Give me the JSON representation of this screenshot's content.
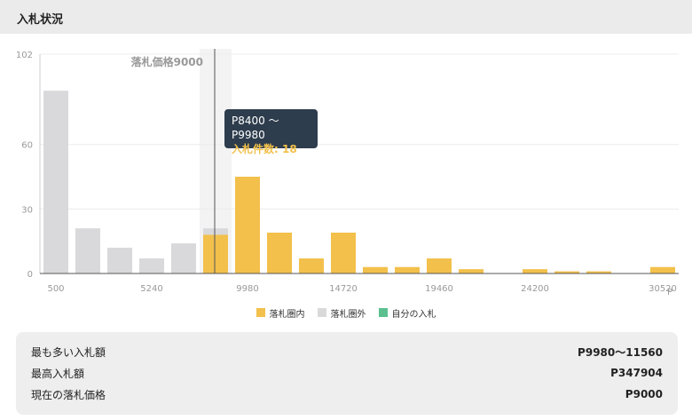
{
  "header": {
    "title": "入札状況"
  },
  "chart_data": {
    "type": "bar",
    "x_tick_labels": [
      "500",
      "5240",
      "9980",
      "14720",
      "19460",
      "24200",
      "30520"
    ],
    "x_unit": "P",
    "y_ticks": [
      0,
      30,
      60,
      102
    ],
    "ylim": [
      0,
      102
    ],
    "reference_line": {
      "label": "落札価格9000",
      "value": 9000
    },
    "bars": [
      {
        "value": 85,
        "status": "out"
      },
      {
        "value": 21,
        "status": "out"
      },
      {
        "value": 12,
        "status": "out"
      },
      {
        "value": 7,
        "status": "out"
      },
      {
        "value": 14,
        "status": "out"
      },
      {
        "value": 18,
        "status": "in",
        "behind": 21
      },
      {
        "value": 45,
        "status": "in"
      },
      {
        "value": 19,
        "status": "in"
      },
      {
        "value": 7,
        "status": "in"
      },
      {
        "value": 19,
        "status": "in"
      },
      {
        "value": 3,
        "status": "in"
      },
      {
        "value": 3,
        "status": "in"
      },
      {
        "value": 7,
        "status": "in"
      },
      {
        "value": 2,
        "status": "in"
      },
      {
        "value": 0,
        "status": "in"
      },
      {
        "value": 2,
        "status": "in"
      },
      {
        "value": 1,
        "status": "in"
      },
      {
        "value": 1,
        "status": "in"
      },
      {
        "value": 0,
        "status": "in"
      },
      {
        "value": 3,
        "status": "in"
      }
    ],
    "highlight_index": 5,
    "tooltip": {
      "range": "P8400 〜 P9980",
      "count": "入札件数: 18"
    },
    "legend": [
      {
        "label": "落札圏内",
        "color": "#f2c04b"
      },
      {
        "label": "落札圏外",
        "color": "#d9d9d9"
      },
      {
        "label": "自分の入札",
        "color": "#5bbf8f"
      }
    ],
    "colors": {
      "in": "#f2c04b",
      "out": "#d9d9dc",
      "grid": "#ececec",
      "axis": "#555555",
      "tick_text": "#999999"
    }
  },
  "summary": {
    "rows": [
      {
        "label": "最も多い入札額",
        "value": "P9980〜11560"
      },
      {
        "label": "最高入札額",
        "value": "P347904"
      },
      {
        "label": "現在の落札価格",
        "value": "P9000"
      }
    ]
  }
}
